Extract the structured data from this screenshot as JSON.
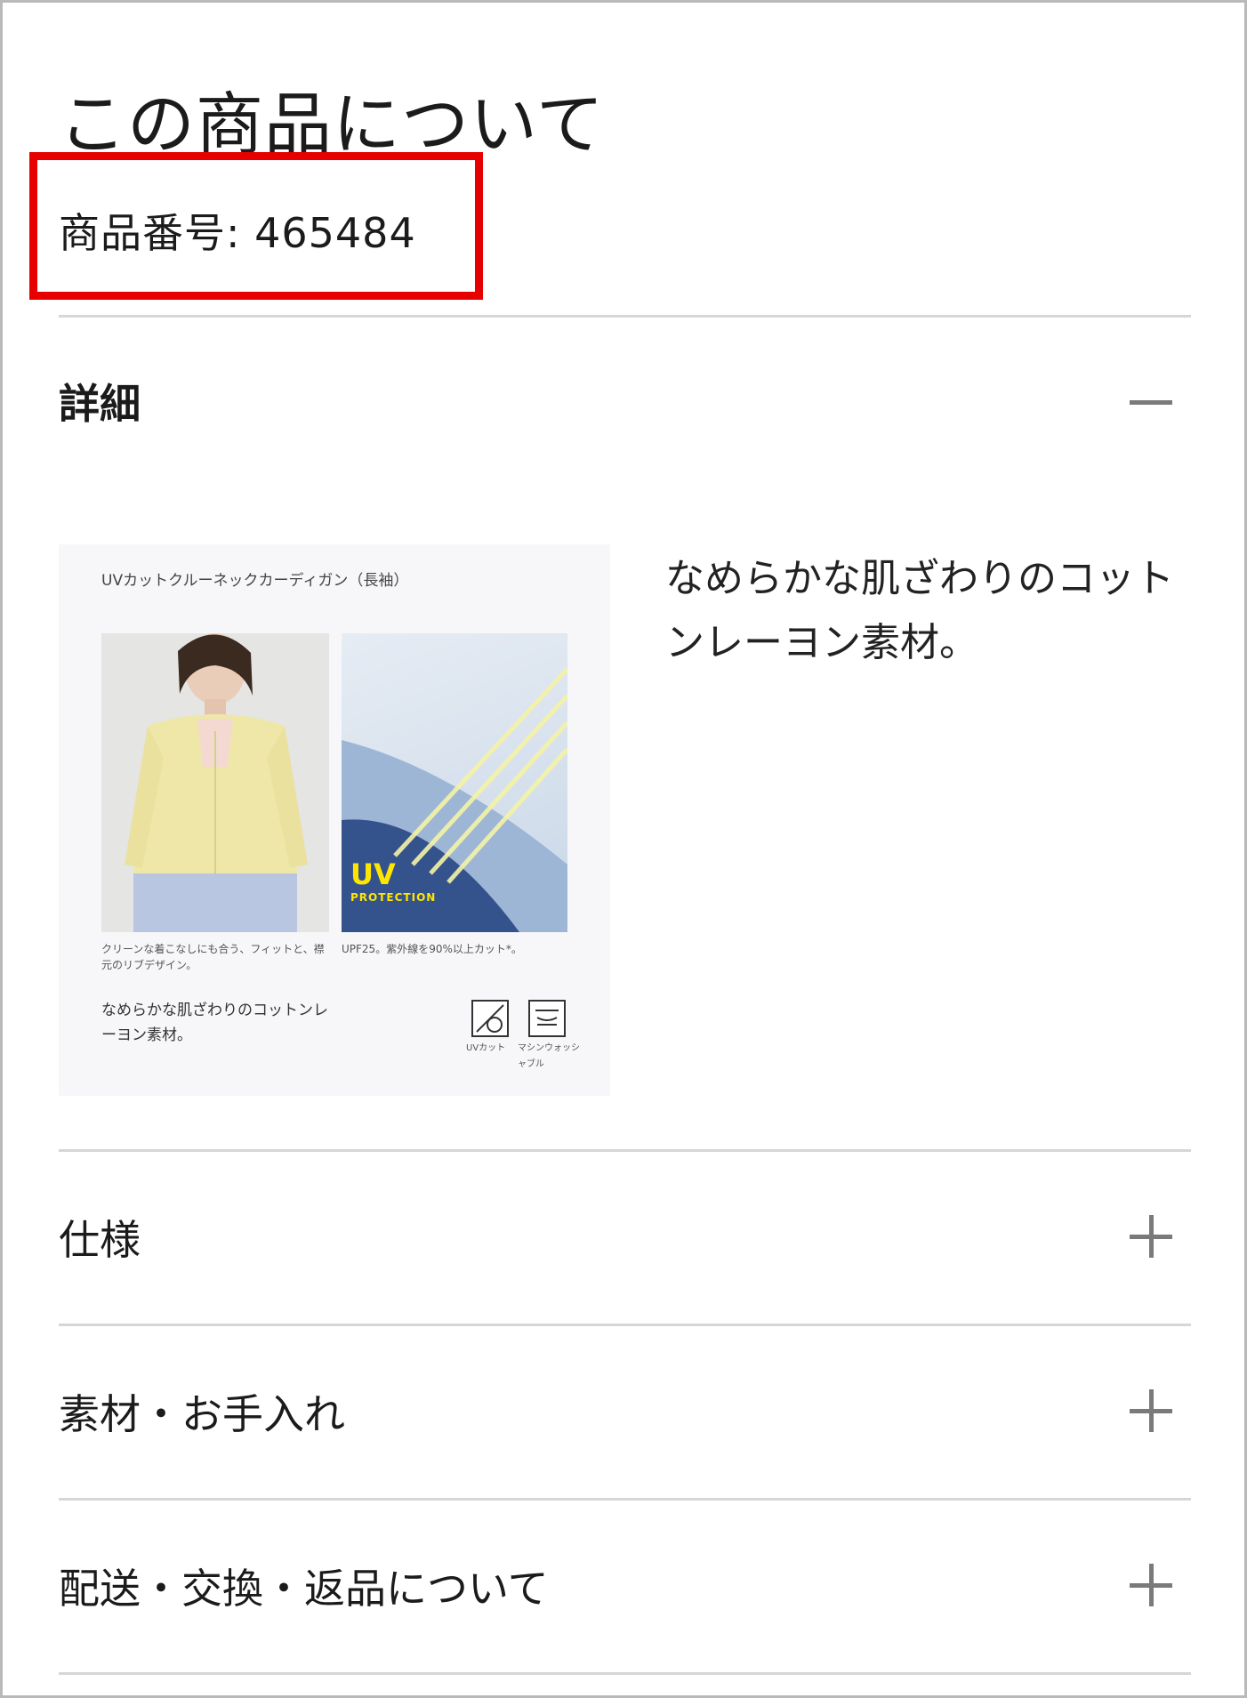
{
  "section": {
    "title": "この商品について",
    "product_number": "商品番号: 465484"
  },
  "details": {
    "title": "詳細",
    "toggle": "collapse",
    "description": "なめらかな肌ざわりのコットンレーヨン素材。",
    "image": {
      "title": "UVカットクルーネックカーディガン（長袖）",
      "caption_left": "クリーンな着こなしにも合う、フィットと、襟元のリブデザイン。",
      "caption_right": "UPF25。紫外線を90%以上カット*。",
      "tagline": "なめらかな肌ざわりのコットンレーヨン素材。",
      "badge_main": "UV",
      "badge_sub": "PROTECTION",
      "icon1_label": "UVカット",
      "icon2_label": "マシンウォッシャブル"
    }
  },
  "accordions": [
    {
      "title": "仕様",
      "toggle": "expand"
    },
    {
      "title": "素材・お手入れ",
      "toggle": "expand"
    },
    {
      "title": "配送・交換・返品について",
      "toggle": "expand"
    }
  ],
  "colors": {
    "highlight": "#e60000",
    "divider": "#d6d6d6",
    "toggle": "#7a7a7a"
  }
}
